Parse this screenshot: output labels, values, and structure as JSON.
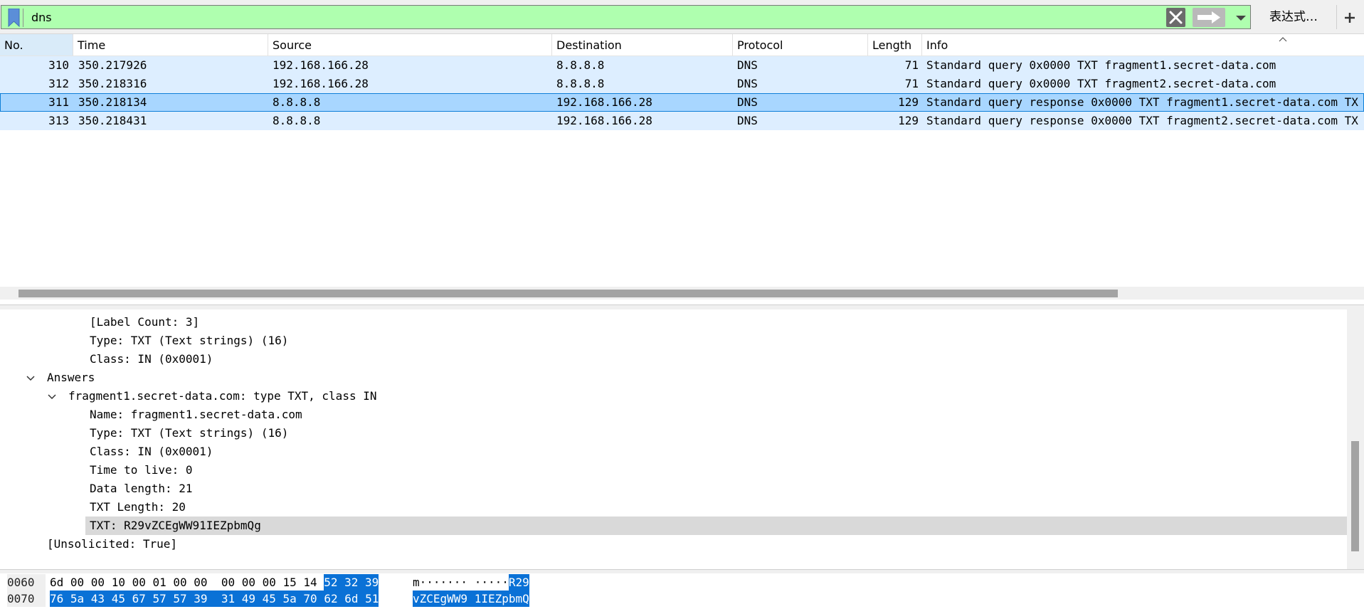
{
  "filter": {
    "value": "dns",
    "expression_label": "表达式…",
    "add_label": "+"
  },
  "packet_list": {
    "columns": [
      "No.",
      "Time",
      "Source",
      "Destination",
      "Protocol",
      "Length",
      "Info"
    ],
    "rows": [
      {
        "no": "310",
        "time": "350.217926",
        "source": "192.168.166.28",
        "destination": "8.8.8.8",
        "protocol": "DNS",
        "length": "71",
        "info": "Standard query 0x0000 TXT fragment1.secret-data.com",
        "selected": false
      },
      {
        "no": "312",
        "time": "350.218316",
        "source": "192.168.166.28",
        "destination": "8.8.8.8",
        "protocol": "DNS",
        "length": "71",
        "info": "Standard query 0x0000 TXT fragment2.secret-data.com",
        "selected": false
      },
      {
        "no": "311",
        "time": "350.218134",
        "source": "8.8.8.8",
        "destination": "192.168.166.28",
        "protocol": "DNS",
        "length": "129",
        "info": "Standard query response 0x0000 TXT fragment1.secret-data.com TX",
        "selected": true
      },
      {
        "no": "313",
        "time": "350.218431",
        "source": "8.8.8.8",
        "destination": "192.168.166.28",
        "protocol": "DNS",
        "length": "129",
        "info": "Standard query response 0x0000 TXT fragment2.secret-data.com TX",
        "selected": false
      }
    ]
  },
  "details": {
    "lines": [
      {
        "text": "[Label Count: 3]",
        "level": 2,
        "expander": "none",
        "selected": false
      },
      {
        "text": "Type: TXT (Text strings) (16)",
        "level": 2,
        "expander": "none",
        "selected": false
      },
      {
        "text": "Class: IN (0x0001)",
        "level": 2,
        "expander": "none",
        "selected": false
      },
      {
        "text": "Answers",
        "level": 0,
        "expander": "expanded",
        "selected": false
      },
      {
        "text": "fragment1.secret-data.com: type TXT, class IN",
        "level": 1,
        "expander": "expanded",
        "selected": false
      },
      {
        "text": "Name: fragment1.secret-data.com",
        "level": 2,
        "expander": "none",
        "selected": false
      },
      {
        "text": "Type: TXT (Text strings) (16)",
        "level": 2,
        "expander": "none",
        "selected": false
      },
      {
        "text": "Class: IN (0x0001)",
        "level": 2,
        "expander": "none",
        "selected": false
      },
      {
        "text": "Time to live: 0",
        "level": 2,
        "expander": "none",
        "selected": false
      },
      {
        "text": "Data length: 21",
        "level": 2,
        "expander": "none",
        "selected": false
      },
      {
        "text": "TXT Length: 20",
        "level": 2,
        "expander": "none",
        "selected": false
      },
      {
        "text": "TXT: R29vZCEgWW91IEZpbmQg",
        "level": 2,
        "expander": "none",
        "selected": true
      },
      {
        "text": "[Unsolicited: True]",
        "level": 0,
        "expander": "none",
        "selected": false
      }
    ]
  },
  "hex": {
    "rows": [
      {
        "offset": "0060",
        "hex_plain": "6d 00 00 10 00 01 00 00  00 00 00 15 14",
        "hex_hl": "52 32 39",
        "ascii_plain": "m······· ·····",
        "ascii_hl": "R29"
      },
      {
        "offset": "0070",
        "hex_plain": "",
        "hex_hl": "76 5a 43 45 67 57 57 39  31 49 45 5a 70 62 6d 51",
        "ascii_plain": "",
        "ascii_hl": "vZCEgWW9 1IEZpbmQ"
      }
    ]
  },
  "colors": {
    "filter_valid_bg": "#afffaf",
    "row_bg": "#ddeeff",
    "row_selected_bg": "#a8d6ff",
    "hex_highlight": "#0a71d6"
  }
}
